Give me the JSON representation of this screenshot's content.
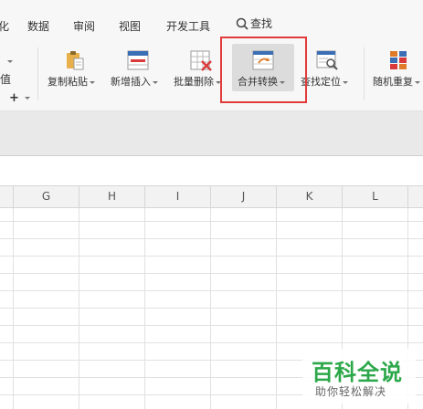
{
  "menu": {
    "partial_left": "化",
    "items": [
      "数据",
      "审阅",
      "视图",
      "开发工具"
    ],
    "search_label": "查找"
  },
  "ribbon_left": {
    "partial_value": "值",
    "plus": "+"
  },
  "ribbon": {
    "buttons": [
      {
        "label": "复制粘贴",
        "icon": "clipboard-paste-icon"
      },
      {
        "label": "新增插入",
        "icon": "insert-table-icon"
      },
      {
        "label": "批量删除",
        "icon": "delete-cells-icon"
      },
      {
        "label": "合并转换",
        "icon": "merge-convert-icon"
      },
      {
        "label": "查找定位",
        "icon": "find-locate-icon"
      },
      {
        "label": "随机重复",
        "icon": "random-repeat-icon"
      }
    ],
    "active_button": "合并转换",
    "highlight_color": "#e33b3b"
  },
  "sheet": {
    "columns": [
      "G",
      "H",
      "I",
      "J",
      "K",
      "L"
    ]
  },
  "watermark": {
    "title": "百科全说",
    "subtitle": "助你轻松解决"
  }
}
